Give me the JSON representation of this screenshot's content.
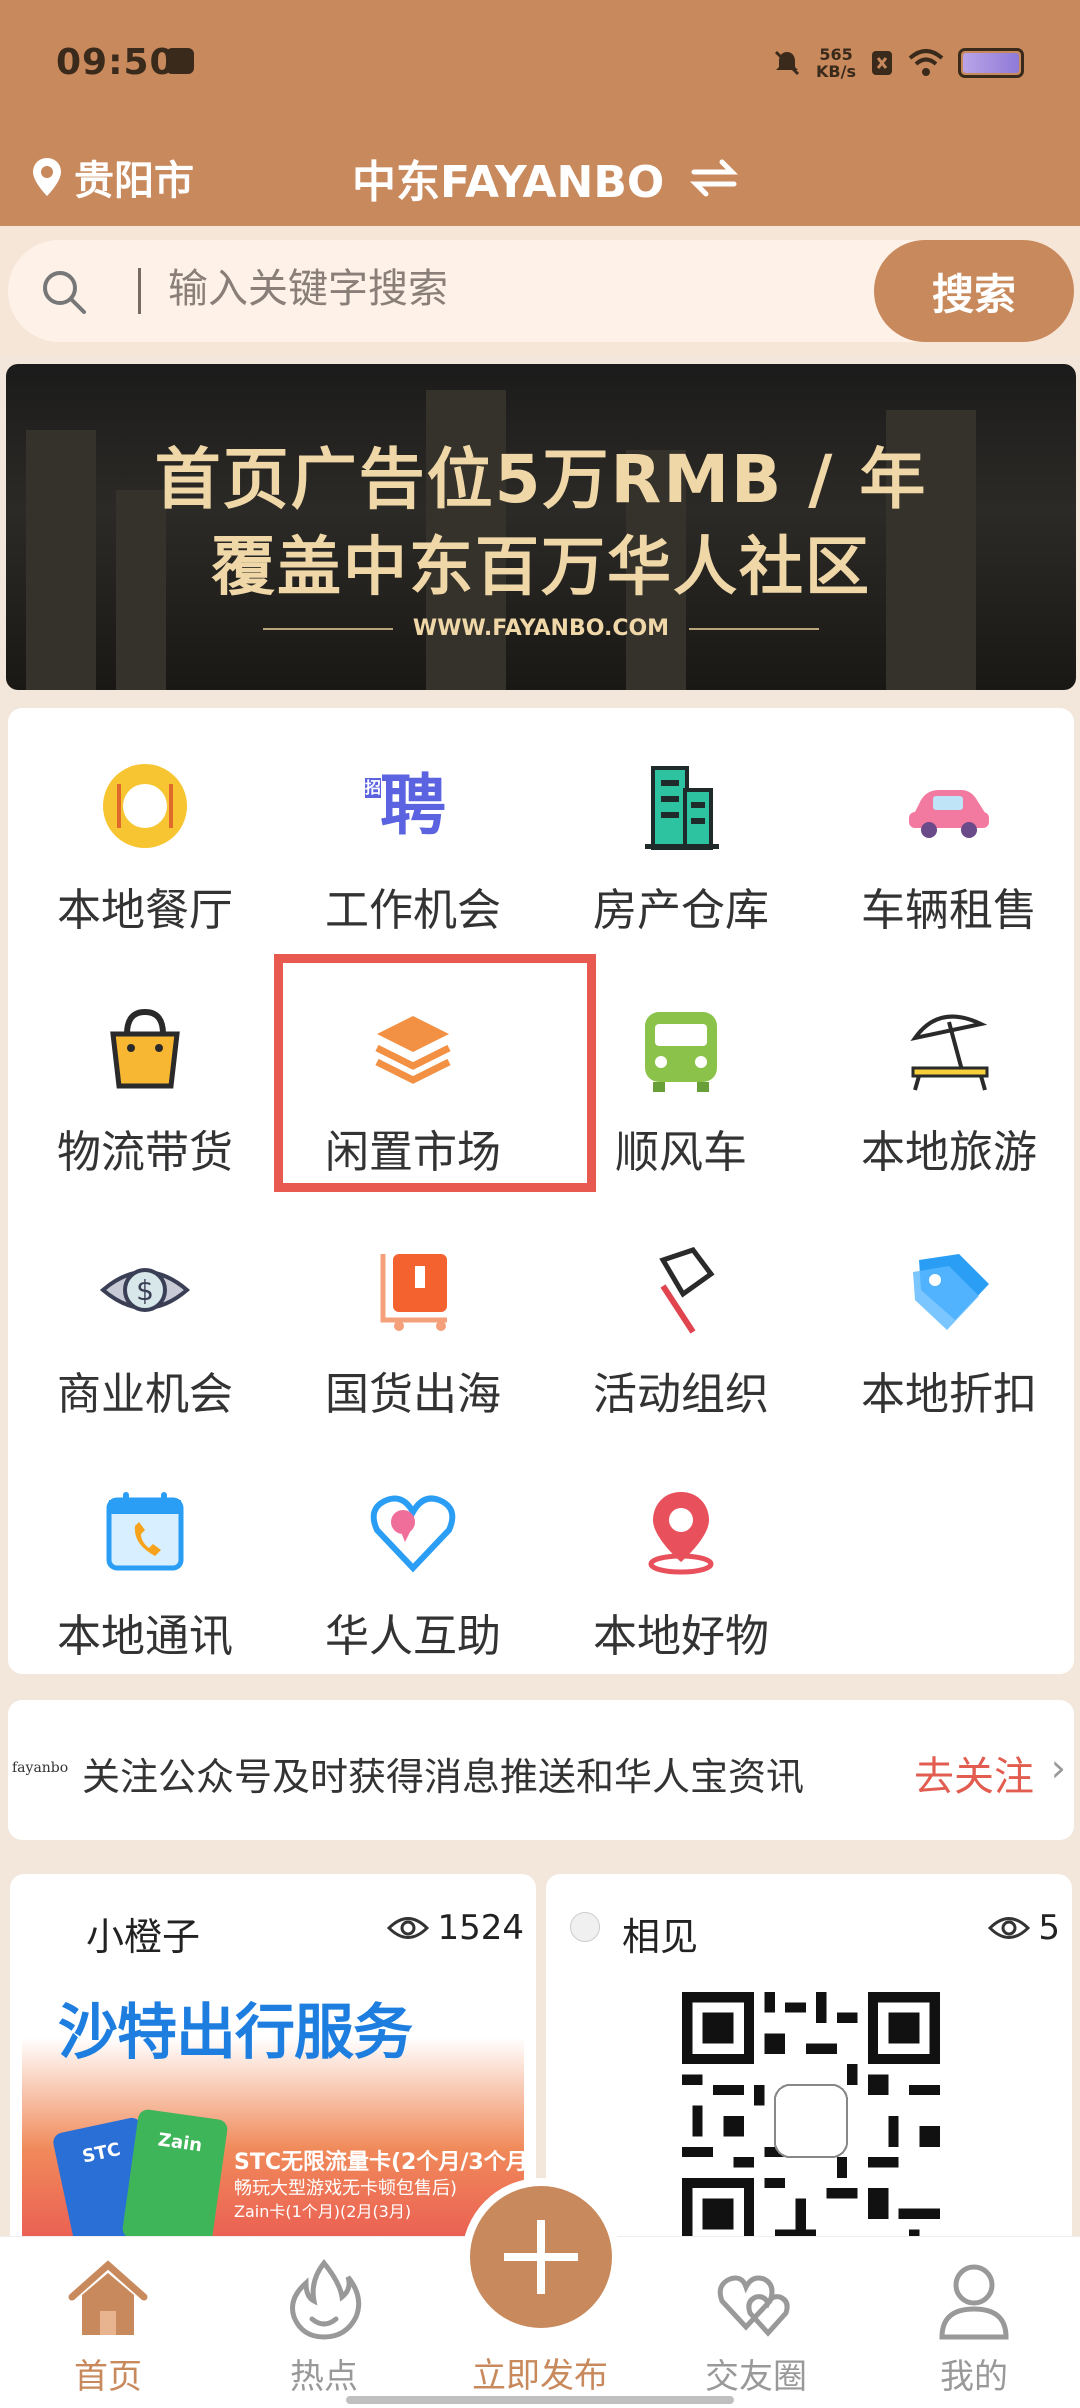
{
  "status_bar": {
    "time": "09:50",
    "speed_value": "565",
    "speed_unit": "KB/s"
  },
  "header": {
    "city": "贵阳市",
    "region": "中东FAYANBO"
  },
  "search": {
    "placeholder": "输入关键字搜索",
    "button": "搜索"
  },
  "banner": {
    "line1": "首页广告位5万RMB / 年",
    "line2": "覆盖中东百万华人社区",
    "url": "WWW.FAYANBO.COM"
  },
  "categories": [
    {
      "label": "本地餐厅",
      "icon": "restaurant-icon"
    },
    {
      "label": "工作机会",
      "icon": "recruit-icon",
      "glyph": "聘",
      "glyph_small": "招"
    },
    {
      "label": "房产仓库",
      "icon": "building-icon"
    },
    {
      "label": "车辆租售",
      "icon": "car-icon"
    },
    {
      "label": "物流带货",
      "icon": "shopping-bag-icon"
    },
    {
      "label": "闲置市场",
      "icon": "layers-icon"
    },
    {
      "label": "顺风车",
      "icon": "bus-icon"
    },
    {
      "label": "本地旅游",
      "icon": "beach-umbrella-icon"
    },
    {
      "label": "商业机会",
      "icon": "dollar-eye-icon"
    },
    {
      "label": "国货出海",
      "icon": "luggage-icon"
    },
    {
      "label": "活动组织",
      "icon": "flag-icon"
    },
    {
      "label": "本地折扣",
      "icon": "tag-icon"
    },
    {
      "label": "本地通讯",
      "icon": "phone-calendar-icon"
    },
    {
      "label": "华人互助",
      "icon": "heart-icon"
    },
    {
      "label": "本地好物",
      "icon": "location-pin-icon"
    }
  ],
  "notice": {
    "logo": "fayanbo",
    "text": "关注公众号及时获得消息推送和华人宝资讯",
    "link": "去关注"
  },
  "feed": [
    {
      "user": "小橙子",
      "views": "1524",
      "promo": {
        "title": "沙特出行服务",
        "line1": "STC无限流量卡(2个月/3个月",
        "line2": "畅玩大型游戏无卡顿包售后)",
        "line3": "Zain卡(1个月)(2月(3月)",
        "card1": "STC",
        "card2": "Zain"
      }
    },
    {
      "user": "相见",
      "views": "5"
    }
  ],
  "bottom_nav": [
    {
      "label": "首页",
      "icon": "home-icon"
    },
    {
      "label": "热点",
      "icon": "flame-icon"
    },
    {
      "label": "立即发布",
      "icon": "plus-icon"
    },
    {
      "label": "交友圈",
      "icon": "hearts-icon"
    },
    {
      "label": "我的",
      "icon": "user-icon"
    }
  ],
  "colors": {
    "brand": "#c8895c",
    "highlight": "#e85a4f",
    "link": "#e25d50"
  }
}
